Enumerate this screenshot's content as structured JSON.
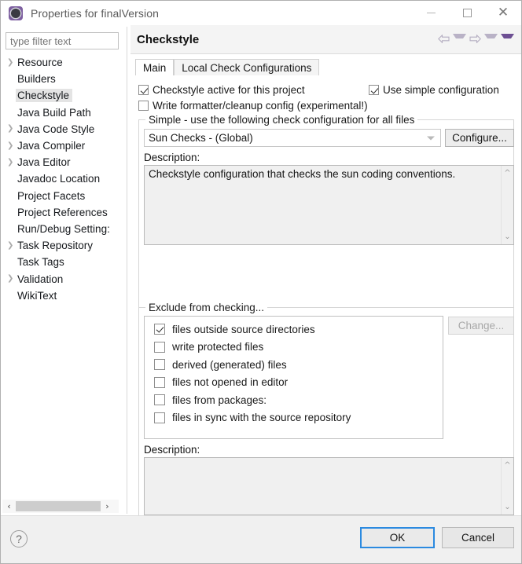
{
  "window": {
    "title": "Properties for finalVersion",
    "icon": "properties-gear-icon",
    "controls": {
      "minimize": "minimize-icon",
      "maximize": "maximize-icon",
      "close": "close-icon"
    }
  },
  "sidebar": {
    "filter": {
      "placeholder": "type filter text",
      "value": ""
    },
    "items": [
      {
        "label": "Resource",
        "expandable": true,
        "selected": false
      },
      {
        "label": "Builders",
        "expandable": false,
        "selected": false
      },
      {
        "label": "Checkstyle",
        "expandable": false,
        "selected": true
      },
      {
        "label": "Java Build Path",
        "expandable": false,
        "selected": false
      },
      {
        "label": "Java Code Style",
        "expandable": true,
        "selected": false
      },
      {
        "label": "Java Compiler",
        "expandable": true,
        "selected": false
      },
      {
        "label": "Java Editor",
        "expandable": true,
        "selected": false
      },
      {
        "label": "Javadoc Location",
        "expandable": false,
        "selected": false
      },
      {
        "label": "Project Facets",
        "expandable": false,
        "selected": false
      },
      {
        "label": "Project References",
        "expandable": false,
        "selected": false
      },
      {
        "label": "Run/Debug Setting:",
        "expandable": false,
        "selected": false
      },
      {
        "label": "Task Repository",
        "expandable": true,
        "selected": false
      },
      {
        "label": "Task Tags",
        "expandable": false,
        "selected": false
      },
      {
        "label": "Validation",
        "expandable": true,
        "selected": false
      },
      {
        "label": "WikiText",
        "expandable": false,
        "selected": false
      }
    ],
    "scroll_left_icon": "chevron-left-icon",
    "scroll_right_icon": "chevron-right-icon"
  },
  "header": {
    "title": "Checkstyle",
    "nav": {
      "back_icon": "arrow-back-icon",
      "back_menu_icon": "chevron-down-icon",
      "forward_icon": "arrow-forward-icon",
      "forward_menu_icon": "chevron-down-icon",
      "view_menu_icon": "chevron-down-filled-icon"
    }
  },
  "tabs": [
    {
      "label": "Main",
      "active": true
    },
    {
      "label": "Local Check Configurations",
      "active": false
    }
  ],
  "main": {
    "checkbox_active": {
      "label": "Checkstyle active for this project",
      "checked": true
    },
    "checkbox_simple": {
      "label": "Use simple configuration",
      "checked": true
    },
    "checkbox_formatter": {
      "label": "Write formatter/cleanup config (experimental!)",
      "checked": false
    },
    "simple_group": {
      "title": "Simple - use the following check configuration for all files",
      "combo_value": "Sun Checks  - (Global)",
      "configure_button": "Configure...",
      "description_label": "Description:",
      "description_text": "Checkstyle configuration that checks the sun coding conventions."
    },
    "exclude_group": {
      "title": "Exclude from checking...",
      "change_button": "Change...",
      "change_button_disabled": true,
      "items": [
        {
          "label": "files outside source directories",
          "checked": true
        },
        {
          "label": "write protected files",
          "checked": false
        },
        {
          "label": "derived (generated) files",
          "checked": false
        },
        {
          "label": "files not opened in editor",
          "checked": false
        },
        {
          "label": "files from packages:",
          "checked": false
        },
        {
          "label": "files in sync with the source repository",
          "checked": false
        }
      ],
      "description_label": "Description:",
      "description_text": ""
    }
  },
  "footer": {
    "help_label": "?",
    "ok_label": "OK",
    "cancel_label": "Cancel"
  },
  "colors": {
    "accent": "#2b8ae0",
    "brand_purple": "#6d4f93",
    "selection": "#e4e4e4"
  }
}
